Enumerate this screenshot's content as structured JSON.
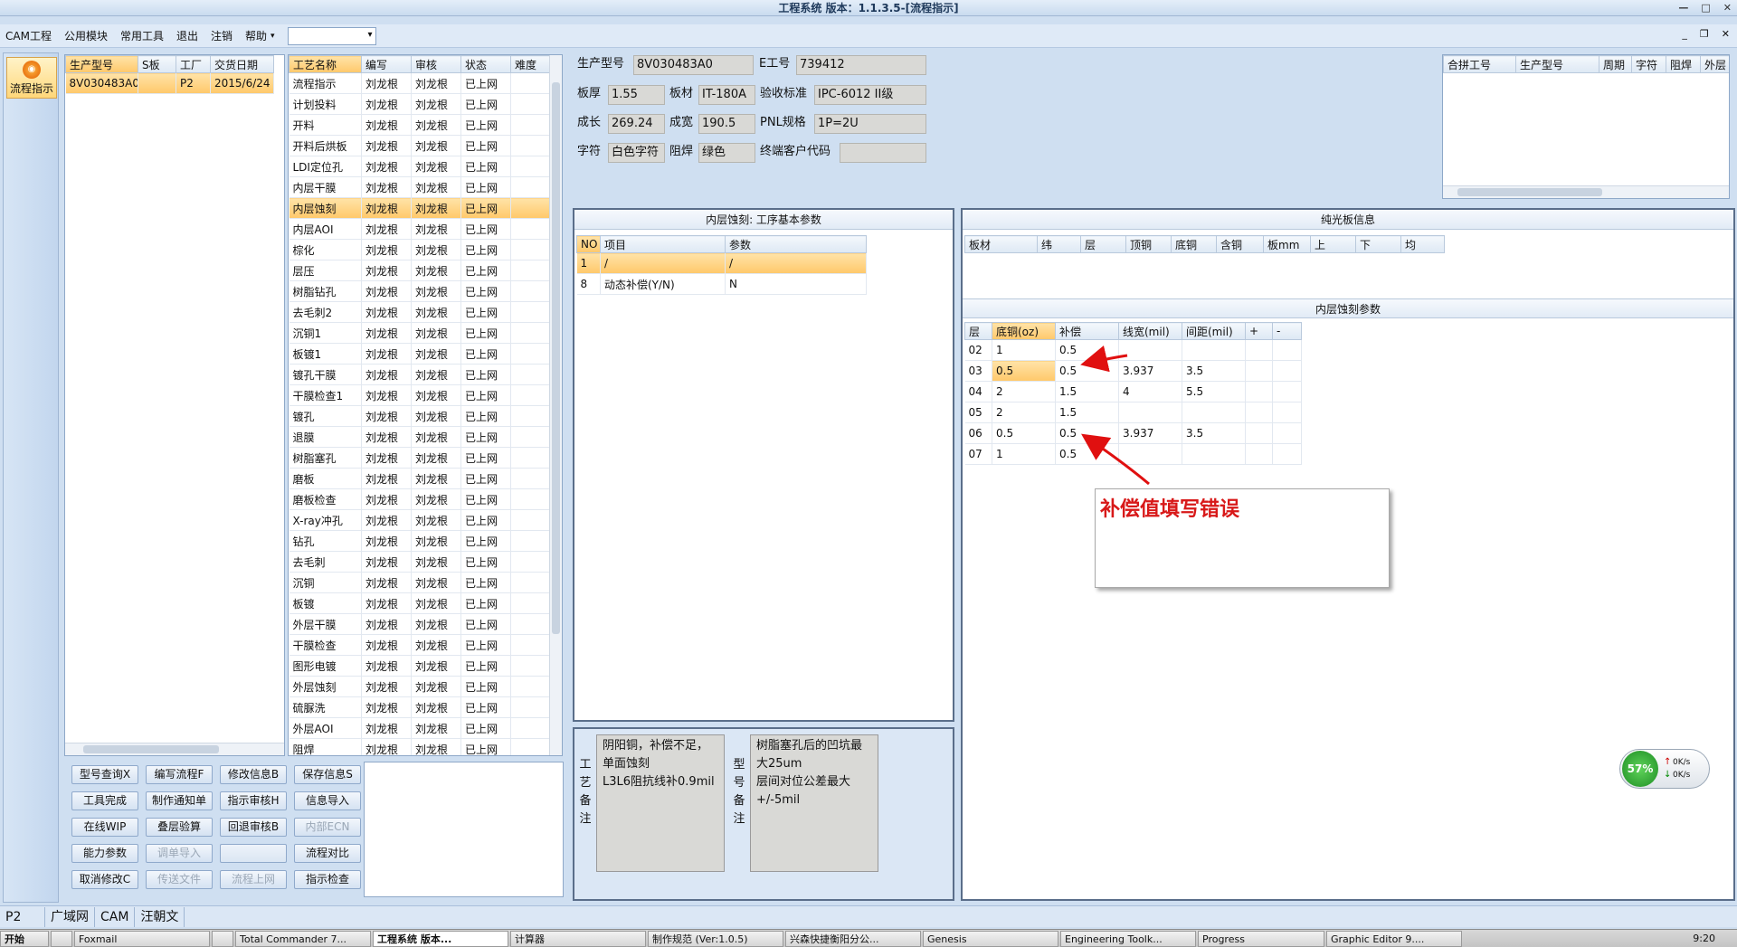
{
  "window": {
    "title": "工程系统 版本：1.1.3.5-[流程指示]"
  },
  "menu": {
    "items": [
      "CAM工程",
      "公用模块",
      "常用工具",
      "退出",
      "注销",
      "帮助"
    ]
  },
  "leftbar": {
    "button": "流程指示"
  },
  "order_table": {
    "columns": [
      "生产型号",
      "S板",
      "工厂",
      "交货日期"
    ],
    "rows": [
      [
        "8V030483A0",
        "",
        "P2",
        "2015/6/24"
      ]
    ]
  },
  "process_table": {
    "columns": [
      "工艺名称",
      "编写",
      "审核",
      "状态",
      "难度"
    ],
    "rows": [
      [
        "流程指示",
        "刘龙根",
        "刘龙根",
        "已上网",
        ""
      ],
      [
        "计划投料",
        "刘龙根",
        "刘龙根",
        "已上网",
        ""
      ],
      [
        "开料",
        "刘龙根",
        "刘龙根",
        "已上网",
        ""
      ],
      [
        "开料后烘板",
        "刘龙根",
        "刘龙根",
        "已上网",
        ""
      ],
      [
        "LDI定位孔",
        "刘龙根",
        "刘龙根",
        "已上网",
        ""
      ],
      [
        "内层干膜",
        "刘龙根",
        "刘龙根",
        "已上网",
        ""
      ],
      [
        "内层蚀刻",
        "刘龙根",
        "刘龙根",
        "已上网",
        ""
      ],
      [
        "内层AOI",
        "刘龙根",
        "刘龙根",
        "已上网",
        ""
      ],
      [
        "棕化",
        "刘龙根",
        "刘龙根",
        "已上网",
        ""
      ],
      [
        "层压",
        "刘龙根",
        "刘龙根",
        "已上网",
        ""
      ],
      [
        "树脂钻孔",
        "刘龙根",
        "刘龙根",
        "已上网",
        ""
      ],
      [
        "去毛刺2",
        "刘龙根",
        "刘龙根",
        "已上网",
        ""
      ],
      [
        "沉铜1",
        "刘龙根",
        "刘龙根",
        "已上网",
        ""
      ],
      [
        "板镀1",
        "刘龙根",
        "刘龙根",
        "已上网",
        ""
      ],
      [
        "镀孔干膜",
        "刘龙根",
        "刘龙根",
        "已上网",
        ""
      ],
      [
        "干膜检查1",
        "刘龙根",
        "刘龙根",
        "已上网",
        ""
      ],
      [
        "镀孔",
        "刘龙根",
        "刘龙根",
        "已上网",
        ""
      ],
      [
        "退膜",
        "刘龙根",
        "刘龙根",
        "已上网",
        ""
      ],
      [
        "树脂塞孔",
        "刘龙根",
        "刘龙根",
        "已上网",
        ""
      ],
      [
        "磨板",
        "刘龙根",
        "刘龙根",
        "已上网",
        ""
      ],
      [
        "磨板检查",
        "刘龙根",
        "刘龙根",
        "已上网",
        ""
      ],
      [
        "X-ray冲孔",
        "刘龙根",
        "刘龙根",
        "已上网",
        ""
      ],
      [
        "钻孔",
        "刘龙根",
        "刘龙根",
        "已上网",
        ""
      ],
      [
        "去毛刺",
        "刘龙根",
        "刘龙根",
        "已上网",
        ""
      ],
      [
        "沉铜",
        "刘龙根",
        "刘龙根",
        "已上网",
        ""
      ],
      [
        "板镀",
        "刘龙根",
        "刘龙根",
        "已上网",
        ""
      ],
      [
        "外层干膜",
        "刘龙根",
        "刘龙根",
        "已上网",
        ""
      ],
      [
        "干膜检查",
        "刘龙根",
        "刘龙根",
        "已上网",
        ""
      ],
      [
        "图形电镀",
        "刘龙根",
        "刘龙根",
        "已上网",
        ""
      ],
      [
        "外层蚀刻",
        "刘龙根",
        "刘龙根",
        "已上网",
        ""
      ],
      [
        "硫脲洗",
        "刘龙根",
        "刘龙根",
        "已上网",
        ""
      ],
      [
        "外层AOI",
        "刘龙根",
        "刘龙根",
        "已上网",
        ""
      ],
      [
        "阻焊",
        "刘龙根",
        "刘龙根",
        "已上网",
        ""
      ]
    ],
    "selected": 6
  },
  "buttons": [
    [
      "型号查询X",
      "编写流程F",
      "修改信息B",
      "保存信息S"
    ],
    [
      "工具完成",
      "制作通知单",
      "指示审核H",
      "信息导入"
    ],
    [
      "在线WIP",
      "叠层验算",
      "回退审核B",
      "内部ECN"
    ],
    [
      "能力参数",
      "调单导入",
      "",
      "流程对比"
    ],
    [
      "取消修改C",
      "传送文件",
      "流程上网",
      "指示检查"
    ]
  ],
  "info": {
    "prod_model_label": "生产型号",
    "prod_model": "8V030483A0",
    "e_label": "E工号",
    "e_no": "739412",
    "thick_label": "板厚",
    "thick": "1.55",
    "mat_label": "板材",
    "mat": "IT-180A",
    "std_label": "验收标准",
    "std": "IPC-6012 II级",
    "len_label": "成长",
    "len": "269.24",
    "wid_label": "成宽",
    "wid": "190.5",
    "pnl_label": "PNL规格",
    "pnl": "1P=2U",
    "char_label": "字符",
    "char": "白色字符",
    "mask_label": "阻焊",
    "mask": "绿色",
    "cust_label": "终端客户代码",
    "cust": ""
  },
  "merge_table": {
    "columns": [
      "合拼工号",
      "生产型号",
      "周期",
      "字符",
      "阻焊",
      "外层"
    ]
  },
  "step_params": {
    "title": "内层蚀刻: 工序基本参数",
    "columns": [
      "NO",
      "项目",
      "参数"
    ],
    "rows": [
      [
        "1",
        "/",
        "/"
      ],
      [
        "8",
        "动态补偿(Y/N)",
        "N"
      ]
    ]
  },
  "plain_board": {
    "title": "纯光板信息",
    "columns": [
      "板材",
      "纬",
      "层",
      "顶铜",
      "底铜",
      "含铜",
      "板mm",
      "上",
      "下",
      "均"
    ]
  },
  "etch_params": {
    "title": "内层蚀刻参数",
    "columns": [
      "层",
      "底铜(oz)",
      "补偿",
      "线宽(mil)",
      "间距(mil)",
      "+",
      "-"
    ],
    "rows": [
      [
        "02",
        "1",
        "0.5",
        "",
        "",
        "",
        ""
      ],
      [
        "03",
        "0.5",
        "0.5",
        "3.937",
        "3.5",
        "",
        ""
      ],
      [
        "04",
        "2",
        "1.5",
        "4",
        "5.5",
        "",
        ""
      ],
      [
        "05",
        "2",
        "1.5",
        "",
        "",
        "",
        ""
      ],
      [
        "06",
        "0.5",
        "0.5",
        "3.937",
        "3.5",
        "",
        ""
      ],
      [
        "07",
        "1",
        "0.5",
        "",
        "",
        "",
        ""
      ]
    ]
  },
  "remarks": {
    "process_label": "工艺备注",
    "process_text": "阴阳铜，补偿不足，单面蚀刻\nL3L6阻抗线补0.9mil",
    "model_label": "型号备注",
    "model_text": "树脂塞孔后的凹坑最大25um\n层间对位公差最大+/-5mil"
  },
  "annotation": {
    "text": "补偿值填写错误"
  },
  "netmeter": {
    "percent": "57%",
    "up": "0K/s",
    "down": "0K/s"
  },
  "statusbar": {
    "segments": [
      "P2",
      "广域网",
      "CAM",
      "汪朝文"
    ]
  },
  "taskbar": {
    "items": [
      "开始",
      "",
      "Foxmail",
      "",
      "Total Commander 7...",
      "工程系统   版本...",
      "计算器",
      "制作规范 (Ver:1.0.5)",
      "兴森快捷衡阳分公...",
      "Genesis",
      "Engineering Toolk...",
      "Progress",
      "Graphic Editor 9...."
    ],
    "clock": "9:20"
  },
  "colors": {
    "selection": "#ffc86a",
    "annotation": "#d81919",
    "panel_bg": "#cfdff1"
  }
}
